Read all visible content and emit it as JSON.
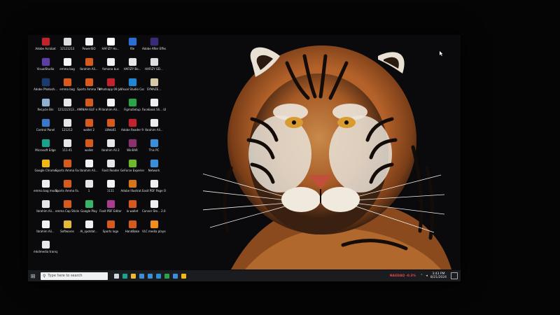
{
  "desktop": {
    "icons": [
      {
        "label": "Adobe Acrobat",
        "color": "#c2222b"
      },
      {
        "label": "12121213",
        "color": "#dddddd"
      },
      {
        "label": "PowerISO",
        "color": "#f2f2f2"
      },
      {
        "label": "HAFIZY Ho...",
        "color": "#ffffff"
      },
      {
        "label": "file",
        "color": "#2a6fd6"
      },
      {
        "label": "Adobe After Effects 2020",
        "color": "#3b2a7a"
      },
      {
        "label": "VisualStudio",
        "color": "#5b3fa6"
      },
      {
        "label": "emma bag",
        "color": "#f5f5f5"
      },
      {
        "label": "Ibrahim Ali...",
        "color": "#d65a1e"
      },
      {
        "label": "fomana bus",
        "color": "#f0f0f0"
      },
      {
        "label": "HAFIZY Bo...",
        "color": "#e6e6e6"
      },
      {
        "label": "HAFIZY GD...",
        "color": "#dedede"
      },
      {
        "label": "Adobe Photosh...",
        "color": "#1a3b6e"
      },
      {
        "label": "emma bag",
        "color": "#d9591e"
      },
      {
        "label": "Sports Amma Thal",
        "color": "#d9591e"
      },
      {
        "label": "Whatsapp 09 Jul 2024",
        "color": "#c4232e"
      },
      {
        "label": "Visual Studio Code",
        "color": "#1f86d1"
      },
      {
        "label": "SYMAZE...",
        "color": "#d7c9a8"
      },
      {
        "label": "Recycle Bin",
        "color": "#8fb0d0"
      },
      {
        "label": "121222313...",
        "color": "#e7e7e7"
      },
      {
        "label": "AMINAH ELIF n PDF28",
        "color": "#d65a1e"
      },
      {
        "label": "Ibrahim Ali...",
        "color": "#f2f2f2"
      },
      {
        "label": "FigmaSetup",
        "color": "#2aa34b"
      },
      {
        "label": "Facebook Sh... UI",
        "color": "#eeeeee"
      },
      {
        "label": "Control Panel",
        "color": "#3a78c9"
      },
      {
        "label": "121212",
        "color": "#e5e5e5"
      },
      {
        "label": "wallet 2",
        "color": "#d65a1e"
      },
      {
        "label": "LWeb01",
        "color": "#d65a1e"
      },
      {
        "label": "Adobe Reader 9",
        "color": "#c4232e"
      },
      {
        "label": "Ibrahim Ali...",
        "color": "#ececec"
      },
      {
        "label": "Microsoft Edge",
        "color": "#1aa38c"
      },
      {
        "label": "111-41",
        "color": "#e6e6e6"
      },
      {
        "label": "wallet",
        "color": "#d65a1e"
      },
      {
        "label": "Ibrahim Ali 2",
        "color": "#e8e8e8"
      },
      {
        "label": "WinRAR",
        "color": "#8e2f6f"
      },
      {
        "label": "This PC",
        "color": "#3b8fd9"
      },
      {
        "label": "Google Chrome",
        "color": "#f1b716"
      },
      {
        "label": "Sports Amma Fav...",
        "color": "#d65a1e"
      },
      {
        "label": "Ibrahim Ali...",
        "color": "#f2f2f2"
      },
      {
        "label": "Foxit Reader",
        "color": "#e6e6e6"
      },
      {
        "label": "GeForce Experience",
        "color": "#6fb82b"
      },
      {
        "label": "Network",
        "color": "#3b8fd9"
      },
      {
        "label": "emma bag mockup",
        "color": "#eeeeee"
      },
      {
        "label": "Sports Amma Fa...",
        "color": "#d65a1e"
      },
      {
        "label": "1",
        "color": "#e6e6e6"
      },
      {
        "label": "1111",
        "color": "#f4f4f4"
      },
      {
        "label": "Adobe Illustrat...",
        "color": "#d8751a"
      },
      {
        "label": "Foxit PDF Page Or...",
        "color": "#eeeeee"
      },
      {
        "label": "Ibrahim Ali...",
        "color": "#e6e6e6"
      },
      {
        "label": "emma Cap Sticker",
        "color": "#d65a1e"
      },
      {
        "label": "Google Play",
        "color": "#39b56a"
      },
      {
        "label": "Foxit PDF Editor",
        "color": "#a93c8e"
      },
      {
        "label": "lo wallet",
        "color": "#d65a1e"
      },
      {
        "label": "Conver Ste... 2.0 Edition",
        "color": "#eeeeee"
      },
      {
        "label": "Ibrahim Ali...",
        "color": "#f1f1f1"
      },
      {
        "label": "Softwares",
        "color": "#e4b93a"
      },
      {
        "label": "AI_spotdat...",
        "color": "#f1f1f1"
      },
      {
        "label": "Sports logo",
        "color": "#d65a1e"
      },
      {
        "label": "HandBake",
        "color": "#d65a1e"
      },
      {
        "label": "VLC media player",
        "color": "#f28c1e"
      },
      {
        "label": "mkdmedia transparent",
        "color": "#e8e8e8"
      }
    ]
  },
  "taskbar": {
    "search_placeholder": "Type here to search",
    "apps": [
      {
        "name": "task-view-icon",
        "color": "#cfd6e0"
      },
      {
        "name": "edge-icon",
        "color": "#1aa38c"
      },
      {
        "name": "file-explorer-icon",
        "color": "#e9b93a"
      },
      {
        "name": "app-grid-icon",
        "color": "#3b8fd9"
      },
      {
        "name": "mail-icon",
        "color": "#3b8fd9"
      },
      {
        "name": "photos-icon",
        "color": "#2a8bd6"
      },
      {
        "name": "xbox-icon",
        "color": "#2aa34b"
      },
      {
        "name": "store-icon",
        "color": "#3b8fd9"
      },
      {
        "name": "chrome-icon",
        "color": "#f1b716"
      }
    ],
    "tray": {
      "market_label": "NASDAQ",
      "market_change": "-0.3%",
      "time": "3:43 PM",
      "date": "8/21/2024"
    }
  }
}
